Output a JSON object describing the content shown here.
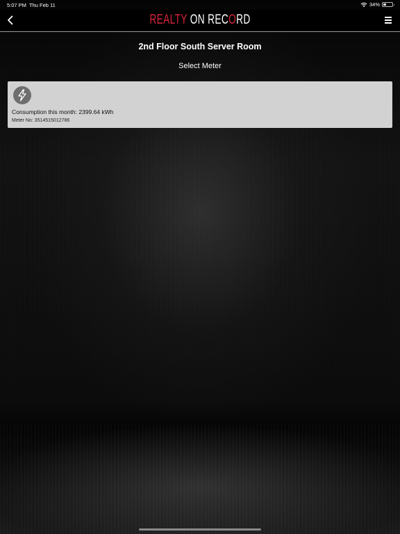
{
  "status_bar": {
    "time": "5:07 PM",
    "date": "Thu Feb 11",
    "battery": "34%",
    "battery_level": 0.34,
    "wifi_icon": "wifi-icon"
  },
  "nav": {
    "logo": {
      "part1": "REALTY",
      "part2": "ON REC",
      "part3": "O",
      "part4": "RD"
    },
    "back_icon": "chevron-left-icon",
    "menu_icon": "hamburger-menu-icon"
  },
  "page": {
    "title": "2nd Floor South Server Room",
    "subtitle": "Select Meter"
  },
  "meters": [
    {
      "icon": "lightning-bolt-icon",
      "consumption": "Consumption this month: 2399.64 kWh",
      "meter_no": "Meter No: 3514515012786"
    }
  ],
  "colors": {
    "brand_red": "#d8243b",
    "card_bg": "#d2d2d2",
    "icon_circle": "#6e6e6e"
  }
}
